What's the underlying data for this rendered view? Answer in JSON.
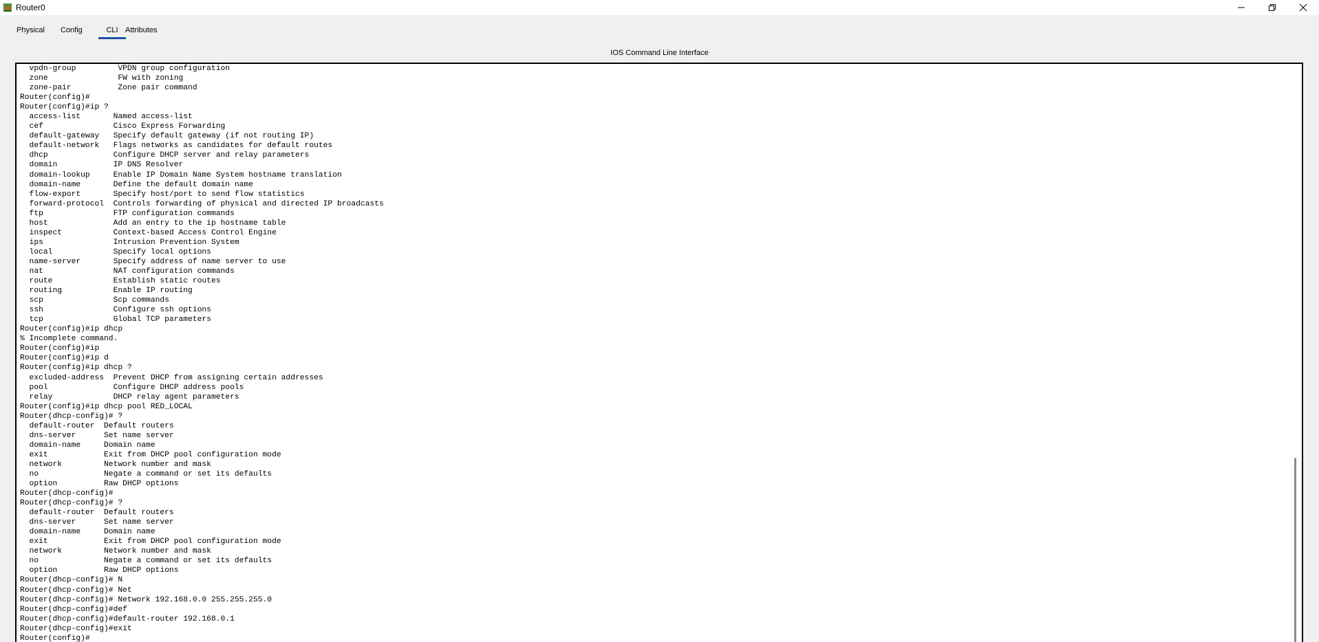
{
  "window": {
    "title": "Router0",
    "icons": {
      "app": "router-icon",
      "minimize": "minimize-icon",
      "maximize": "restore-icon",
      "close": "close-icon"
    }
  },
  "tabs": [
    {
      "label": "Physical",
      "active": false
    },
    {
      "label": "Config",
      "active": false
    },
    {
      "label": "CLI",
      "active": true
    },
    {
      "label": "Attributes",
      "active": false
    }
  ],
  "panel": {
    "header": "IOS Command Line Interface"
  },
  "terminal": {
    "lines": [
      "  vpdn-group         VPDN group configuration",
      "  zone               FW with zoning",
      "  zone-pair          Zone pair command",
      "Router(config)#",
      "Router(config)#ip ?",
      "  access-list       Named access-list",
      "  cef               Cisco Express Forwarding",
      "  default-gateway   Specify default gateway (if not routing IP)",
      "  default-network   Flags networks as candidates for default routes",
      "  dhcp              Configure DHCP server and relay parameters",
      "  domain            IP DNS Resolver",
      "  domain-lookup     Enable IP Domain Name System hostname translation",
      "  domain-name       Define the default domain name",
      "  flow-export       Specify host/port to send flow statistics",
      "  forward-protocol  Controls forwarding of physical and directed IP broadcasts",
      "  ftp               FTP configuration commands",
      "  host              Add an entry to the ip hostname table",
      "  inspect           Context-based Access Control Engine",
      "  ips               Intrusion Prevention System",
      "  local             Specify local options",
      "  name-server       Specify address of name server to use",
      "  nat               NAT configuration commands",
      "  route             Establish static routes",
      "  routing           Enable IP routing",
      "  scp               Scp commands",
      "  ssh               Configure ssh options",
      "  tcp               Global TCP parameters",
      "Router(config)#ip dhcp",
      "% Incomplete command.",
      "Router(config)#ip",
      "Router(config)#ip d",
      "Router(config)#ip dhcp ?",
      "  excluded-address  Prevent DHCP from assigning certain addresses",
      "  pool              Configure DHCP address pools",
      "  relay             DHCP relay agent parameters",
      "Router(config)#ip dhcp pool RED_LOCAL",
      "Router(dhcp-config)# ?",
      "  default-router  Default routers",
      "  dns-server      Set name server",
      "  domain-name     Domain name",
      "  exit            Exit from DHCP pool configuration mode",
      "  network         Network number and mask",
      "  no              Negate a command or set its defaults",
      "  option          Raw DHCP options",
      "Router(dhcp-config)#",
      "Router(dhcp-config)# ?",
      "  default-router  Default routers",
      "  dns-server      Set name server",
      "  domain-name     Domain name",
      "  exit            Exit from DHCP pool configuration mode",
      "  network         Network number and mask",
      "  no              Negate a command or set its defaults",
      "  option          Raw DHCP options",
      "Router(dhcp-config)# N",
      "Router(dhcp-config)# Net",
      "Router(dhcp-config)# Network 192.168.0.0 255.255.255.0",
      "Router(dhcp-config)#def",
      "Router(dhcp-config)#default-router 192.168.0.1",
      "Router(dhcp-config)#exit",
      "Router(config)#"
    ]
  }
}
